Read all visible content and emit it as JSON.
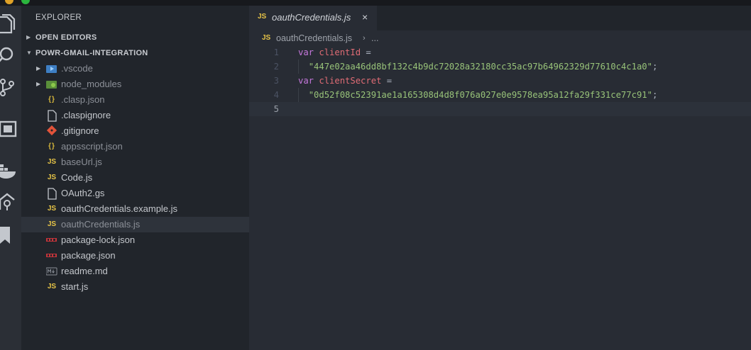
{
  "titlebar": {
    "text": "· · · ·  ·  · ·  · ·"
  },
  "activity_bar": {
    "items": [
      {
        "name": "explorer",
        "icon": "files-icon"
      },
      {
        "name": "search",
        "icon": "search-icon"
      },
      {
        "name": "source-control",
        "icon": "source-control-icon"
      },
      {
        "name": "extensions",
        "icon": "extensions-icon"
      },
      {
        "name": "docker",
        "icon": "docker-icon"
      },
      {
        "name": "gitlens",
        "icon": "gitlens-icon"
      },
      {
        "name": "bookmarks",
        "icon": "bookmark-icon"
      }
    ]
  },
  "sidebar": {
    "title": "EXPLORER",
    "open_editors_label": "OPEN EDITORS",
    "project_label": "POWR-GMAIL-INTEGRATION",
    "files": [
      {
        "name": ".vscode",
        "type": "folder",
        "icon": "vscode-folder-icon"
      },
      {
        "name": "node_modules",
        "type": "folder",
        "icon": "node-folder-icon"
      },
      {
        "name": ".clasp.json",
        "type": "json",
        "icon": "json-icon"
      },
      {
        "name": ".claspignore",
        "type": "file",
        "icon": "file-icon"
      },
      {
        "name": ".gitignore",
        "type": "git",
        "icon": "git-icon"
      },
      {
        "name": "appsscript.json",
        "type": "json",
        "icon": "json-icon"
      },
      {
        "name": "baseUrl.js",
        "type": "js",
        "icon": "js-icon"
      },
      {
        "name": "Code.js",
        "type": "js",
        "icon": "js-icon"
      },
      {
        "name": "OAuth2.gs",
        "type": "file",
        "icon": "file-icon"
      },
      {
        "name": "oauthCredentials.example.js",
        "type": "js",
        "icon": "js-icon"
      },
      {
        "name": "oauthCredentials.js",
        "type": "js",
        "icon": "js-icon"
      },
      {
        "name": "package-lock.json",
        "type": "npm",
        "icon": "npm-icon"
      },
      {
        "name": "package.json",
        "type": "npm",
        "icon": "npm-icon"
      },
      {
        "name": "readme.md",
        "type": "md",
        "icon": "markdown-icon"
      },
      {
        "name": "start.js",
        "type": "js",
        "icon": "js-icon"
      }
    ],
    "selected": "oauthCredentials.js"
  },
  "editor": {
    "tab": {
      "badge": "JS",
      "label": "oauthCredentials.js",
      "close": "×"
    },
    "breadcrumbs": {
      "badge": "JS",
      "file": "oauthCredentials.js",
      "sep": "›",
      "more": "..."
    },
    "lines": [
      {
        "num": "1",
        "kw": "var",
        "name": "clientId",
        "rest": " ="
      },
      {
        "num": "2",
        "string": "\"447e02aa46dd8bf132c4b9dc72028a32180cc35ac97b64962329d77610c4c1a0\"",
        "end": ";"
      },
      {
        "num": "3",
        "kw": "var",
        "name": "clientSecret",
        "rest": " ="
      },
      {
        "num": "4",
        "string": "\"0d52f08c52391ae1a165308d4d8f076a027e0e9578ea95a12fa29f331ce77c91\"",
        "end": ";"
      },
      {
        "num": "5"
      }
    ]
  },
  "colors": {
    "sidebar_bg": "#21252b",
    "editor_bg": "#282c34",
    "keyword": "#c678dd",
    "variable": "#e06c75",
    "string": "#98c379"
  }
}
